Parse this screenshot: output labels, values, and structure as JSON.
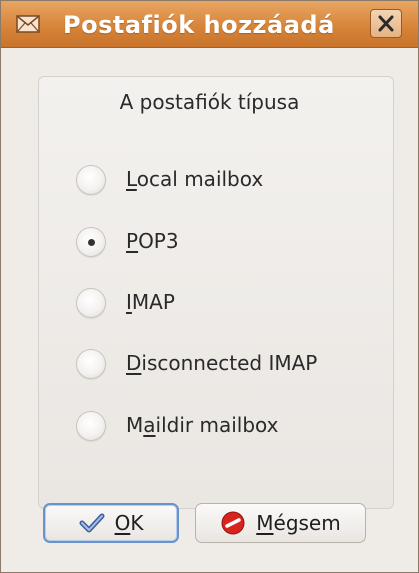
{
  "dialog": {
    "title": "Postafiók hozzáadá",
    "close_label": "x"
  },
  "group": {
    "title": "A postafiók típusa",
    "options": [
      {
        "prefix": "",
        "accel": "L",
        "rest": "ocal mailbox",
        "selected": false
      },
      {
        "prefix": "",
        "accel": "P",
        "rest": "OP3",
        "selected": true
      },
      {
        "prefix": "",
        "accel": "I",
        "rest": "MAP",
        "selected": false
      },
      {
        "prefix": "",
        "accel": "D",
        "rest": "isconnected IMAP",
        "selected": false
      },
      {
        "prefix": "M",
        "accel": "a",
        "rest": "ildir mailbox",
        "selected": false
      }
    ]
  },
  "buttons": {
    "ok": {
      "accel": "O",
      "rest": "K",
      "icon": "checkmark-icon"
    },
    "cancel": {
      "accel": "M",
      "rest": "égsem",
      "icon": "cancel-icon"
    }
  },
  "colors": {
    "titlebar": "#d7853a",
    "focus_border": "#6a92cf",
    "cancel_icon": "#d9231c",
    "checkmark": "#5a7fbf"
  }
}
